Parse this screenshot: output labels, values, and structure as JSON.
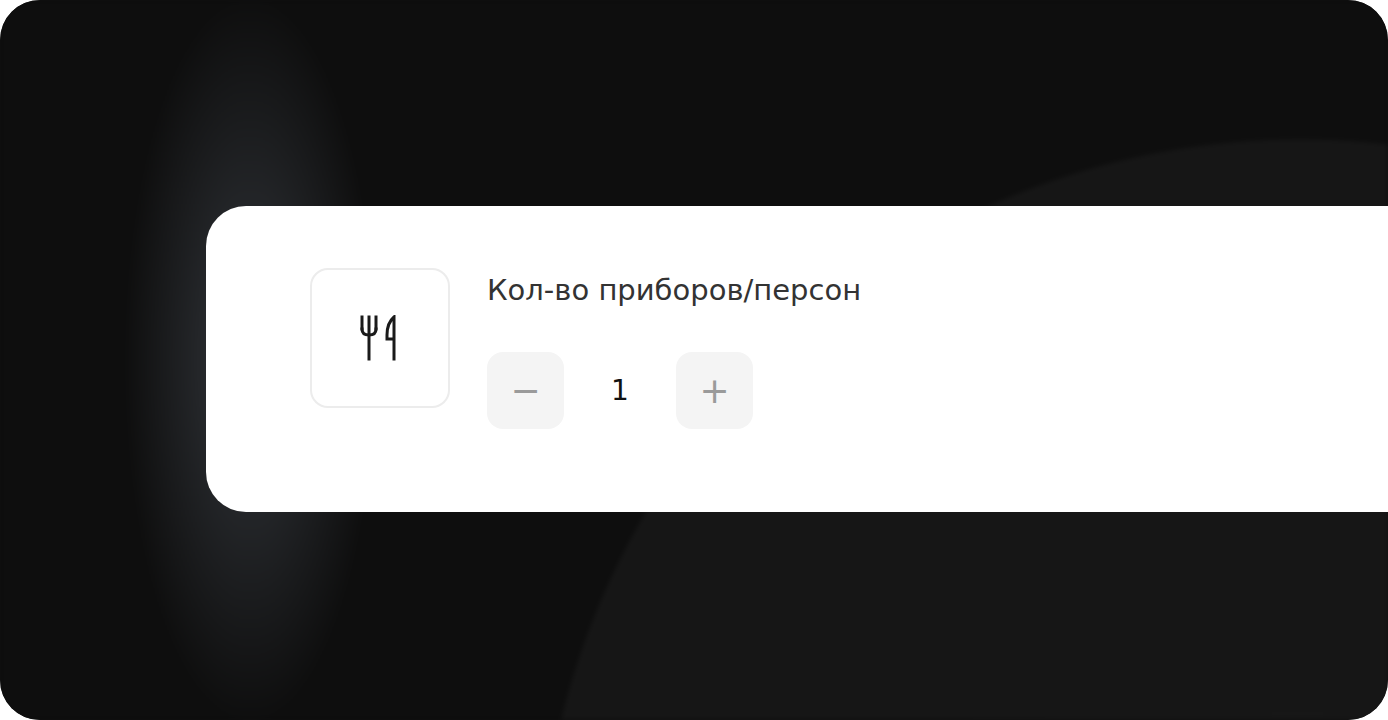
{
  "setting": {
    "title": "Кол-во приборов/персон",
    "value": "1",
    "decrement": "−",
    "increment": "+"
  }
}
